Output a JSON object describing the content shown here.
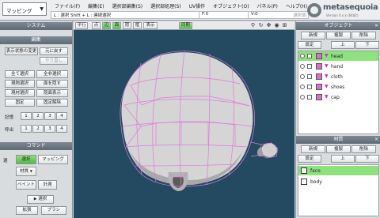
{
  "mode": {
    "value": "マッピング"
  },
  "menu": [
    "ファイル(F)",
    "編集(E)",
    "選択部編集(S)",
    "選択部処理(S)",
    "UV操作",
    "オブジェクト(O)",
    "パネル(P)",
    "ヘルプ(H)"
  ],
  "hint": {
    "text": "L : 選択 Shift + L : 連続選択",
    "f": "F:0",
    "v": "V:0",
    "end": "選択面"
  },
  "logo": {
    "name": "metasequoia 4",
    "version": "Version 4.x.x (64bit)"
  },
  "left": {
    "system_title": "システム",
    "edit_title": "編集",
    "edit_buttons": {
      "restore_display": "表示状態の変更",
      "undo": "元に戻す",
      "redo": "やり直し",
      "select_all": "全て選択",
      "deselect_all": "全非選択",
      "select_current": "現物選択",
      "hide_faces": "面を隠す",
      "current_select": "現材選択",
      "hide_show": "隠面表示",
      "fix": "固定",
      "unfix": "固定解除"
    },
    "memory_label": "記憶",
    "recall_label": "呼出",
    "slots": [
      "1",
      "2",
      "3",
      "4"
    ],
    "command_title": "コマンド",
    "command_side_label": "選",
    "command_buttons": {
      "select": "選択",
      "mapping": "マッピング",
      "material": "材質",
      "paint": "ペイント",
      "measure": "計測",
      "select2": "選択",
      "expand": "拡張",
      "plus": "プラシ"
    }
  },
  "viewport": {
    "toolbar": {
      "ortho": "平行",
      "point": "点",
      "edge": "辺",
      "face": "面",
      "hidden": "隠",
      "frame": "框",
      "display": "表示",
      "simultaneous": "同期"
    },
    "colors": {
      "background": "#234a61",
      "wire": "#e07ad6",
      "mesh": "#d4d4d4"
    }
  },
  "objects": {
    "title": "オブジェクト",
    "buttons": {
      "new": "新規",
      "duplicate": "複製",
      "delete": "削除",
      "settings": "設定",
      "up": "上",
      "down": "下"
    },
    "items": [
      {
        "name": "head",
        "selected": true
      },
      {
        "name": "hand",
        "selected": false
      },
      {
        "name": "cloth",
        "selected": false
      },
      {
        "name": "shoes",
        "selected": false
      },
      {
        "name": "cap",
        "selected": false
      }
    ]
  },
  "materials": {
    "title": "材質",
    "buttons": {
      "new": "新規",
      "duplicate": "複製",
      "delete": "削除",
      "settings": "設定",
      "up": "上",
      "down": "下"
    },
    "items": [
      {
        "name": "face",
        "selected": true
      },
      {
        "name": "body",
        "selected": false
      }
    ]
  }
}
